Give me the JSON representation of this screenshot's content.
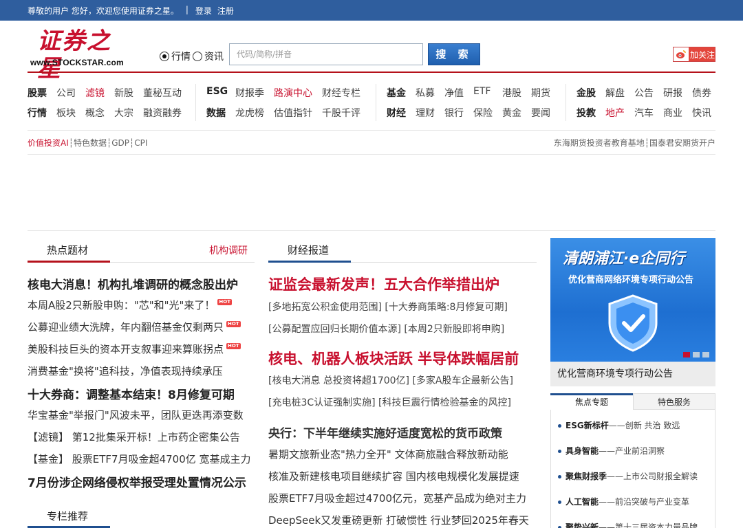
{
  "topbar": {
    "greeting": "尊敬的用户 您好，欢迎您使用证券之星。",
    "separator": "|",
    "login": "登录",
    "register": "注册"
  },
  "header": {
    "logo_text": "证券之星",
    "logo_domain": "www.STOCKSTAR.com",
    "radio_quotes": "行情",
    "radio_news": "资讯",
    "search_placeholder": "代码/简称/拼音",
    "search_button": "搜 索",
    "weibo_follow": "加关注"
  },
  "nav": {
    "g1r1": [
      "股票",
      "公司",
      "滤镜",
      "新股",
      "董秘互动"
    ],
    "g1r2": [
      "行情",
      "板块",
      "概念",
      "大宗",
      "融资融券"
    ],
    "g2r1": [
      "ESG",
      "财报季",
      "路演中心",
      "财经专栏"
    ],
    "g2r2": [
      "数据",
      "龙虎榜",
      "估值指针",
      "千股千评"
    ],
    "g3r1": [
      "基金",
      "私募",
      "净值",
      "ETF",
      "港股",
      "期货"
    ],
    "g3r2": [
      "财经",
      "理财",
      "银行",
      "保险",
      "黄金",
      "要闻"
    ],
    "g4r1": [
      "金股",
      "解盘",
      "公告",
      "研报",
      "债券"
    ],
    "g4r2": [
      "投教",
      "地产",
      "汽车",
      "商业",
      "快讯"
    ]
  },
  "sublinks": {
    "left": [
      "价值投资AI",
      "特色数据",
      "GDP",
      "CPI"
    ],
    "right": [
      "东海期货投资者教育基地",
      "国泰君安期货开户"
    ]
  },
  "left_col": {
    "tab_active": "热点题材",
    "tab_right": "机构调研",
    "headline1": "核电大消息！机构扎堆调研的概念股出炉",
    "items1": [
      "本周A股2只新股申购：\"芯\"和\"光\"来了！",
      "公募迎业绩大洗牌，年内翻倍基金仅剩两只",
      "美股科技巨头的资本开支叙事迎来算账拐点",
      "消费基金\"换将\"追科技，净值表现持续承压"
    ],
    "hot_label": "HOT",
    "headline2": "十大券商：调整基本结束！8月修复可期",
    "items2": [
      "华宝基金\"举报门\"风波未平，团队更迭再添变数",
      "【滤镜】 第12批集采开标！上市药企密集公告",
      "【基金】 股票ETF7月吸金超4700亿 宽基成主力"
    ],
    "headline3": "7月份涉企网络侵权举报受理处置情况公示",
    "column_tab": "专栏推荐"
  },
  "mid_col": {
    "tab_active": "财经报道",
    "big1": "证监会最新发声！五大合作举措出炉",
    "row1a": "[多地拓宽公积金使用范围] [十大券商策略:8月修复可期]",
    "row1b": "[公募配置应回归长期价值本源] [本周2只新股即将申购]",
    "big2": "核电、机器人板块活跃 半导体跌幅居前",
    "row2a": "[核电大消息 总投资将超1700亿] [多家A股车企最新公告]",
    "row2b": "[充电桩3C认证强制实施] [科技巨震行情检验基金的风控]",
    "headline3": "央行：下半年继续实施好适度宽松的货币政策",
    "items3": [
      "暑期文旅新业态\"热力全开\" 文体商旅融合释放新动能",
      "核准及新建核电项目继续扩容 国内核电规模化发展提速",
      "股票ETF7月吸金超过4700亿元，宽基产品成为绝对主力",
      "DeepSeek又发重磅更新 打破惯性 行业梦回2025年春天"
    ]
  },
  "right_col": {
    "banner_title": "清朗浦江·e企同行",
    "banner_sub": "优化营商网络环境专项行动公告",
    "banner_caption": "优化营商环境专项行动公告",
    "tab_active": "焦点专题",
    "tab_other": "特色服务",
    "focus": [
      {
        "title": "ESG新标杆",
        "desc": "——创新 共治 致远"
      },
      {
        "title": "具身智能",
        "desc": "——产业前沿洞察"
      },
      {
        "title": "聚焦财报季",
        "desc": "——上市公司财报全解读"
      },
      {
        "title": "人工智能",
        "desc": "——前沿突破与产业变革"
      },
      {
        "title": "聚势兴新",
        "desc": "——第十三届资本力量品牌"
      }
    ]
  }
}
